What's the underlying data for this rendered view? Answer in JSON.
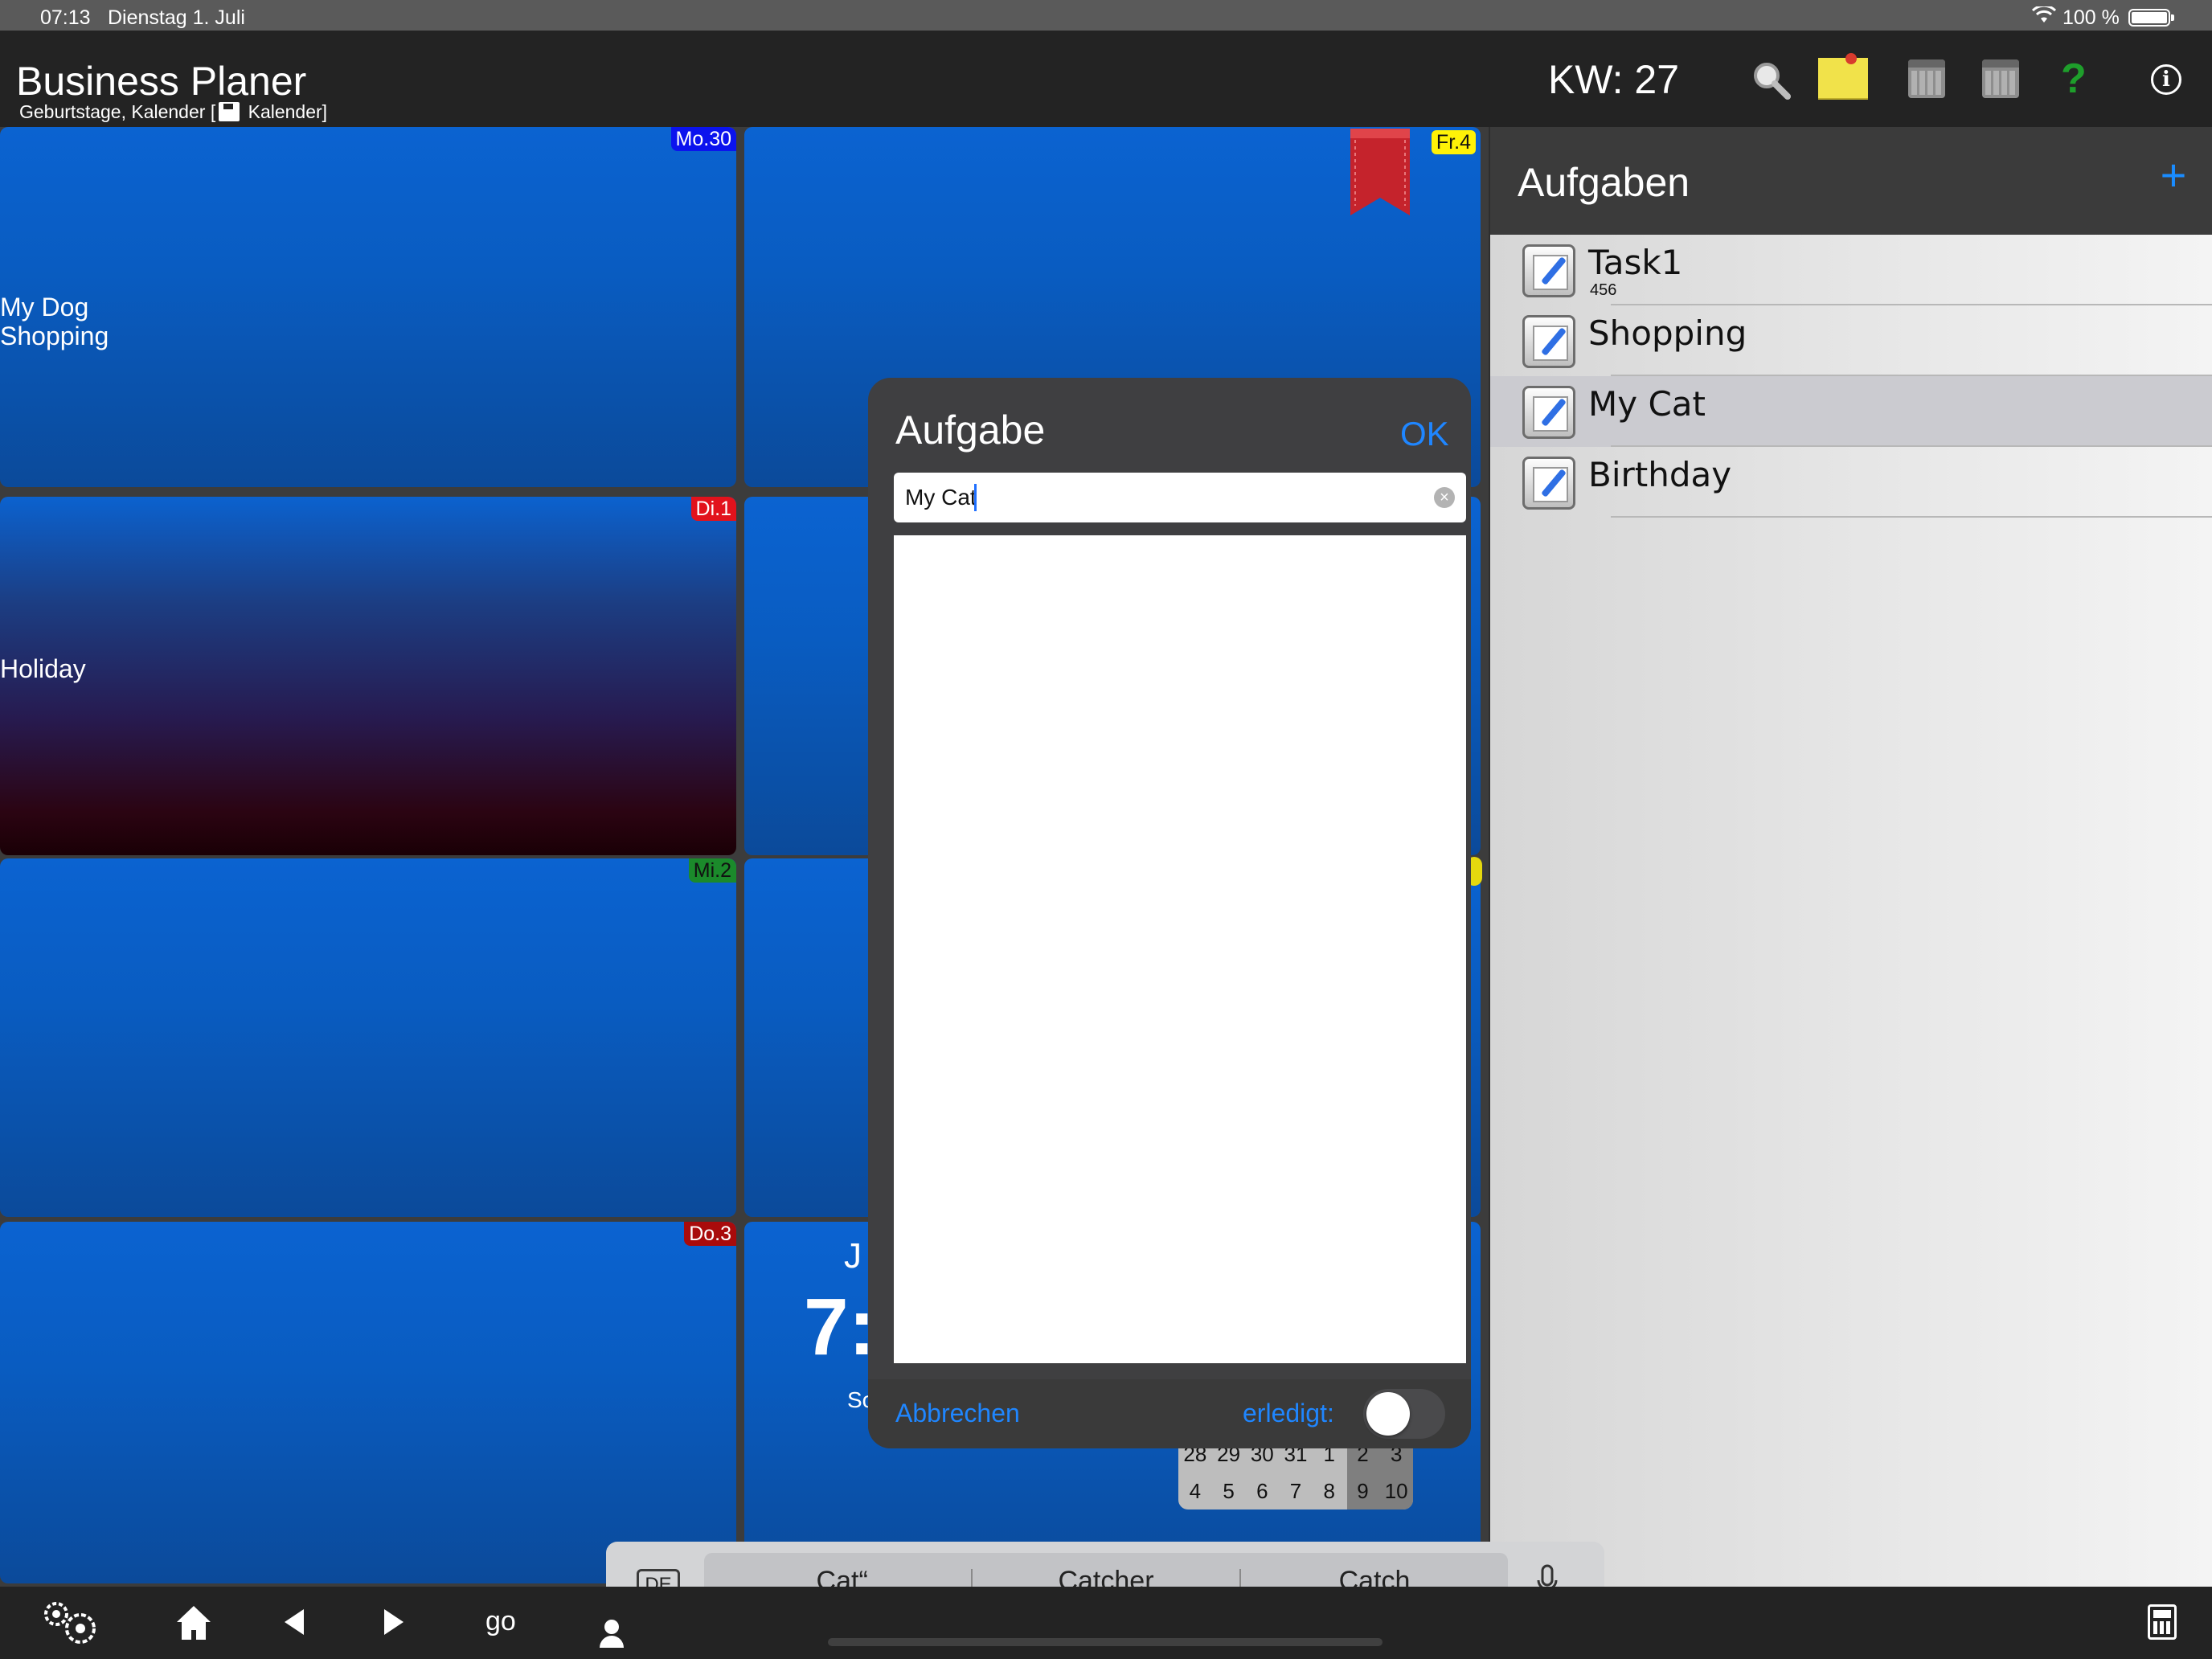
{
  "status": {
    "time": "07:13",
    "date": "Dienstag 1. Juli",
    "battery": "100 %"
  },
  "header": {
    "title": "Business Planer",
    "subtitle_before": "Geburtstage, Kalender [",
    "subtitle_after": " Kalender]",
    "week": "KW: 27",
    "icons": [
      "search-icon",
      "note-icon",
      "calendar-icon",
      "calendar-icon",
      "help-icon",
      "info-icon"
    ],
    "help_glyph": "?",
    "info_glyph": "i",
    "lang": "de"
  },
  "calendar": {
    "days": {
      "mo": "Mo.30",
      "di": "Di.1",
      "mi": "Mi.2",
      "do": "Do.3",
      "fr": "Fr.4"
    },
    "monday_events": [
      "My Dog",
      "Shopping"
    ],
    "tuesday_events": [
      "Holiday"
    ],
    "clock": {
      "month_letter": "J",
      "time": "7:",
      "weekday_prefix": "So"
    },
    "mini_calendar": {
      "row1": [
        "28",
        "29",
        "30",
        "31",
        "1",
        "2",
        "3"
      ],
      "row2": [
        "4",
        "5",
        "6",
        "7",
        "8",
        "9",
        "10"
      ]
    }
  },
  "tasks": {
    "title": "Aufgaben",
    "add_label": "+",
    "items": [
      {
        "name": "Task1",
        "sub": "456"
      },
      {
        "name": "Shopping",
        "sub": ""
      },
      {
        "name": "My Cat",
        "sub": ""
      },
      {
        "name": "Birthday",
        "sub": ""
      }
    ]
  },
  "modal": {
    "title": "Aufgabe",
    "ok": "OK",
    "input_value": "My Cat",
    "cancel": "Abbrechen",
    "done_label": "erledigt:",
    "done": false
  },
  "keyboard": {
    "lang": "DE",
    "suggestions": [
      "„Cat“",
      "Catcher",
      "Catch"
    ]
  },
  "toolbar": {
    "go": "go"
  },
  "colors": {
    "accent": "#1f86ff",
    "cell_blue": "#0b63d1",
    "badge_mo": "#0b13ee",
    "badge_di": "#e2121c",
    "badge_mi": "#1b8a2b",
    "badge_do": "#a90b0b",
    "badge_fr": "#fff207"
  }
}
